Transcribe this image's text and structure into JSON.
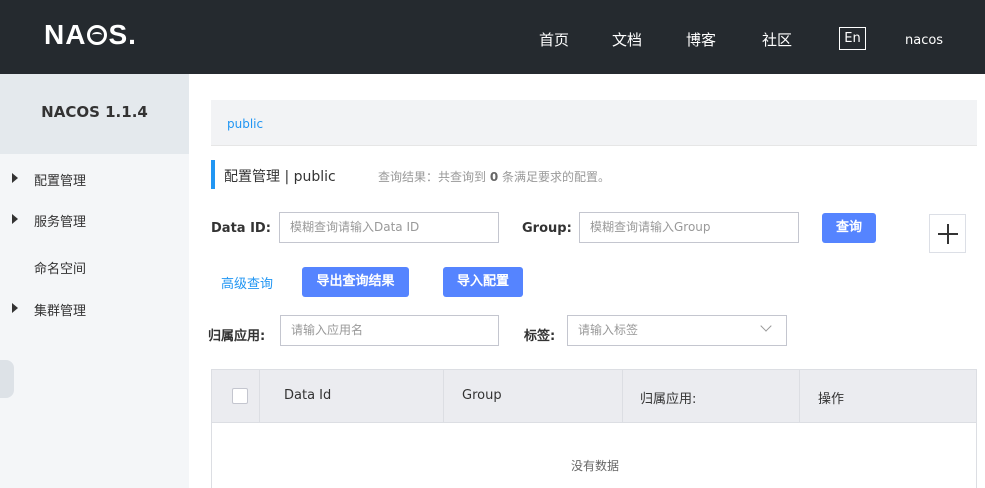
{
  "header": {
    "logo_pre": "NA",
    "logo_post": "S.",
    "nav": [
      "首页",
      "文档",
      "博客",
      "社区"
    ],
    "lang": "En",
    "user": "nacos"
  },
  "sidebar": {
    "title": "NACOS 1.1.4",
    "items": [
      {
        "label": "配置管理",
        "expandable": true
      },
      {
        "label": "服务管理",
        "expandable": true
      },
      {
        "label": "命名空间",
        "expandable": false
      },
      {
        "label": "集群管理",
        "expandable": true
      }
    ]
  },
  "breadcrumb": {
    "namespace": "public"
  },
  "page": {
    "title": "配置管理 | public",
    "result_pre": "查询结果：共查询到",
    "result_count": "0",
    "result_post": "条满足要求的配置。"
  },
  "form": {
    "dataid_label": "Data ID:",
    "dataid_placeholder": "模糊查询请输入Data ID",
    "group_label": "Group:",
    "group_placeholder": "模糊查询请输入Group",
    "query_btn": "查询",
    "advanced": "高级查询",
    "export_btn": "导出查询结果",
    "import_btn": "导入配置",
    "app_label": "归属应用:",
    "app_placeholder": "请输入应用名",
    "tag_label": "标签:",
    "tag_placeholder": "请输入标签"
  },
  "table": {
    "columns": [
      "Data Id",
      "Group",
      "归属应用:",
      "操作"
    ],
    "empty": "没有数据"
  },
  "colors": {
    "header_bg": "#252a2f",
    "primary": "#5584ff",
    "link": "#2196f3"
  }
}
